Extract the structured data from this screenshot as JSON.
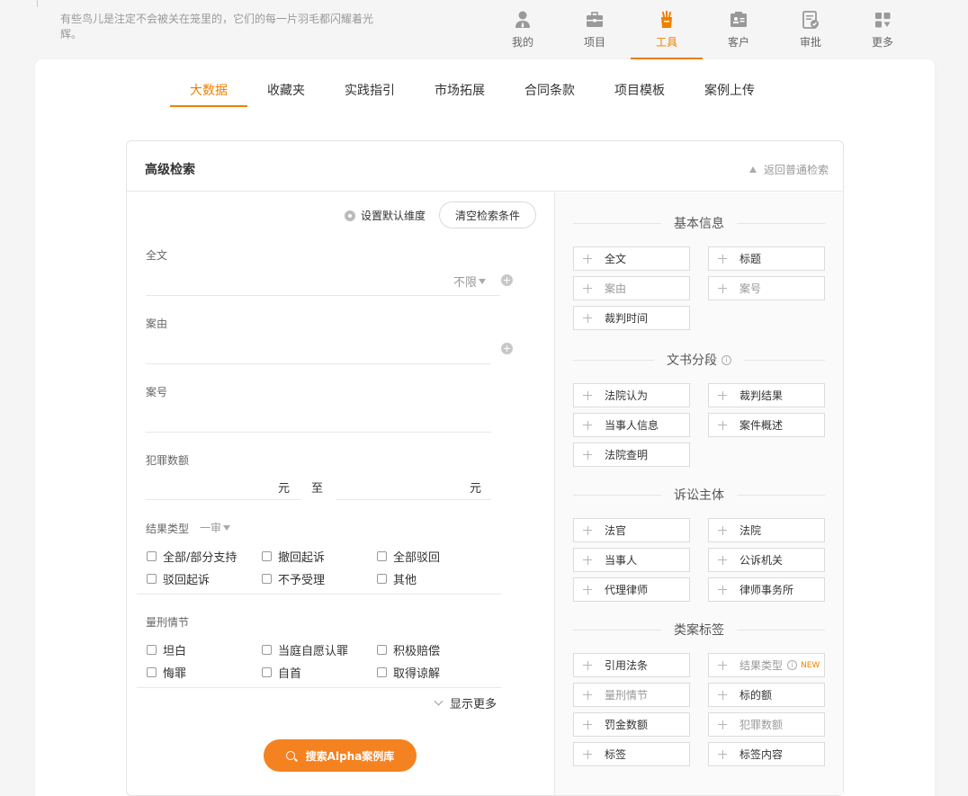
{
  "header": {
    "slogan": "有些鸟儿是注定不会被关在笼里的，它们的每一片羽毛都闪耀着光辉。",
    "nav": [
      {
        "label": "我的",
        "icon": "person-icon",
        "active": false
      },
      {
        "label": "项目",
        "icon": "briefcase-icon",
        "active": false
      },
      {
        "label": "工具",
        "icon": "tools-icon",
        "active": true
      },
      {
        "label": "客户",
        "icon": "contact-card-icon",
        "active": false
      },
      {
        "label": "审批",
        "icon": "approval-icon",
        "active": false
      },
      {
        "label": "更多",
        "icon": "more-grid-icon",
        "active": false
      }
    ],
    "accent_color": "#f08000"
  },
  "tabs": [
    {
      "label": "大数据",
      "active": true
    },
    {
      "label": "收藏夹",
      "active": false
    },
    {
      "label": "实践指引",
      "active": false
    },
    {
      "label": "市场拓展",
      "active": false
    },
    {
      "label": "合同条款",
      "active": false
    },
    {
      "label": "项目模板",
      "active": false
    },
    {
      "label": "案例上传",
      "active": false
    }
  ],
  "panel": {
    "title": "高级检索",
    "back_link": "返回普通检索",
    "set_default": "设置默认维度",
    "clear": "清空检索条件",
    "fields": {
      "fulltext": {
        "label": "全文",
        "scope": "不限"
      },
      "cause": {
        "label": "案由"
      },
      "caseno": {
        "label": "案号"
      },
      "amount": {
        "label": "犯罪数额",
        "unit": "元",
        "to": "至"
      },
      "result_type": {
        "label": "结果类型",
        "instance": "一审",
        "options": [
          "全部/部分支持",
          "撤回起诉",
          "全部驳回",
          "驳回起诉",
          "不予受理",
          "其他"
        ]
      },
      "sentencing": {
        "label": "量刑情节",
        "options": [
          "坦白",
          "当庭自愿认罪",
          "积极赔偿",
          "悔罪",
          "自首",
          "取得谅解"
        ]
      }
    },
    "show_more": "显示更多",
    "search_button": "搜索Alpha案例库"
  },
  "dimensions": {
    "basic": {
      "title": "基本信息",
      "items": [
        "全文",
        "标题",
        "案由",
        "案号",
        "裁判时间"
      ]
    },
    "segments": {
      "title": "文书分段",
      "items": [
        "法院认为",
        "裁判结果",
        "当事人信息",
        "案件概述",
        "法院查明"
      ]
    },
    "parties": {
      "title": "诉讼主体",
      "items": [
        "法官",
        "法院",
        "当事人",
        "公诉机关",
        "代理律师",
        "律师事务所"
      ]
    },
    "tags": {
      "title": "类案标签",
      "items": [
        "引用法条",
        "结果类型",
        "量刑情节",
        "标的额",
        "罚金数额",
        "犯罪数额",
        "标签",
        "标签内容"
      ],
      "new_badge": "NEW"
    }
  }
}
